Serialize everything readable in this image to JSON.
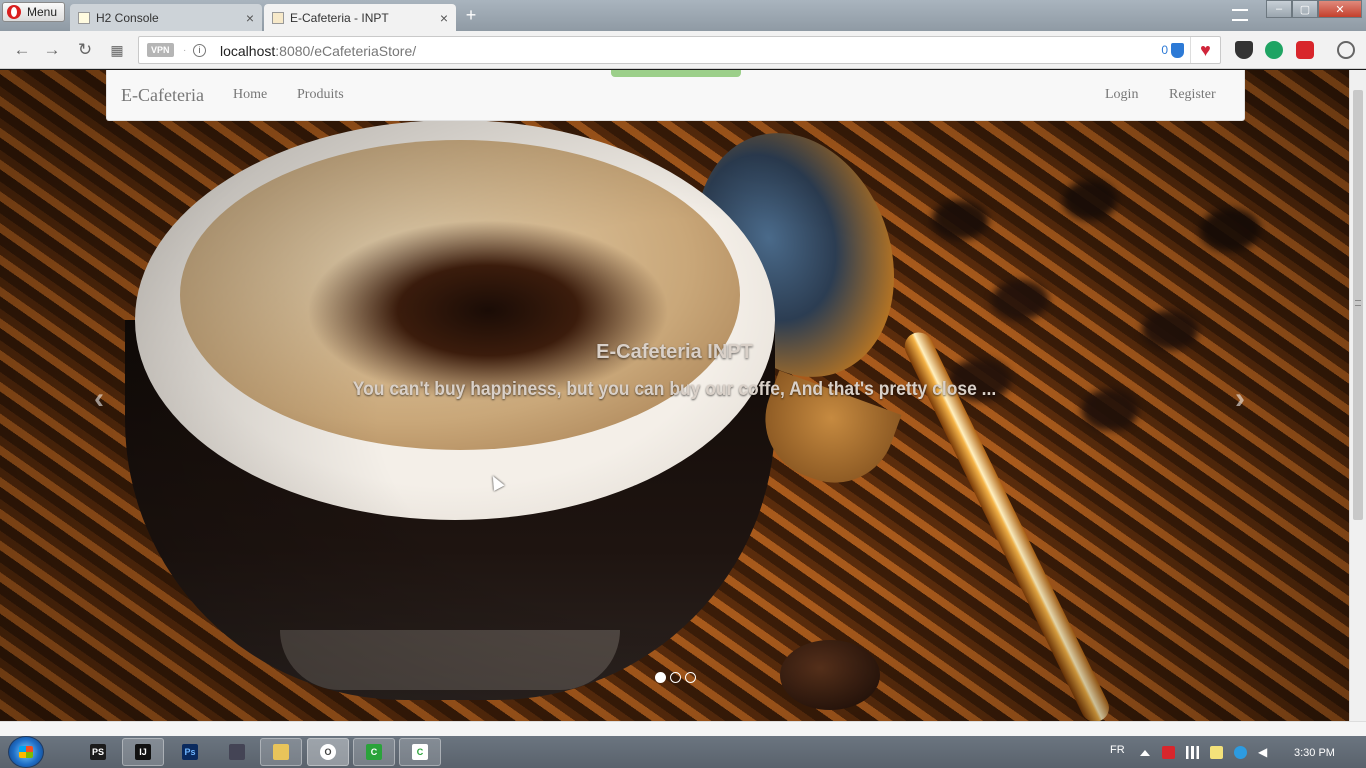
{
  "browser": {
    "menu_label": "Menu",
    "tabs": [
      {
        "title": "H2 Console",
        "active": false
      },
      {
        "title": "E-Cafeteria - INPT",
        "active": true
      }
    ],
    "new_tab": "+",
    "close_glyph": "×",
    "window_controls": {
      "minimize": "–",
      "maximize": "▢",
      "close": "✕"
    },
    "vpn_label": "VPN",
    "url_host": "localhost",
    "url_rest": ":8080/eCafeteriaStore/",
    "adblock_count": "0",
    "heart": "♥"
  },
  "site": {
    "brand": "E-Cafeteria",
    "nav_left": [
      "Home",
      "Produits"
    ],
    "nav_right": [
      "Login",
      "Register"
    ],
    "carousel": {
      "title": "E-Cafeteria INPT",
      "text": "You can't buy happiness, but you can buy our coffe, And that's pretty close ...",
      "prev": "‹",
      "next": "›",
      "slide_count": 3,
      "active_slide": 1
    }
  },
  "taskbar": {
    "apps": [
      "PS",
      "IJ",
      "Ps",
      "",
      "",
      "O",
      "C",
      "C"
    ],
    "language": "FR",
    "time": "3:30 PM"
  },
  "colors": {
    "nav_bg": "#f8f8f8",
    "nav_text": "#777777",
    "caption_text": "#d9d0c8",
    "loading_bar": "#9ccf8a"
  }
}
